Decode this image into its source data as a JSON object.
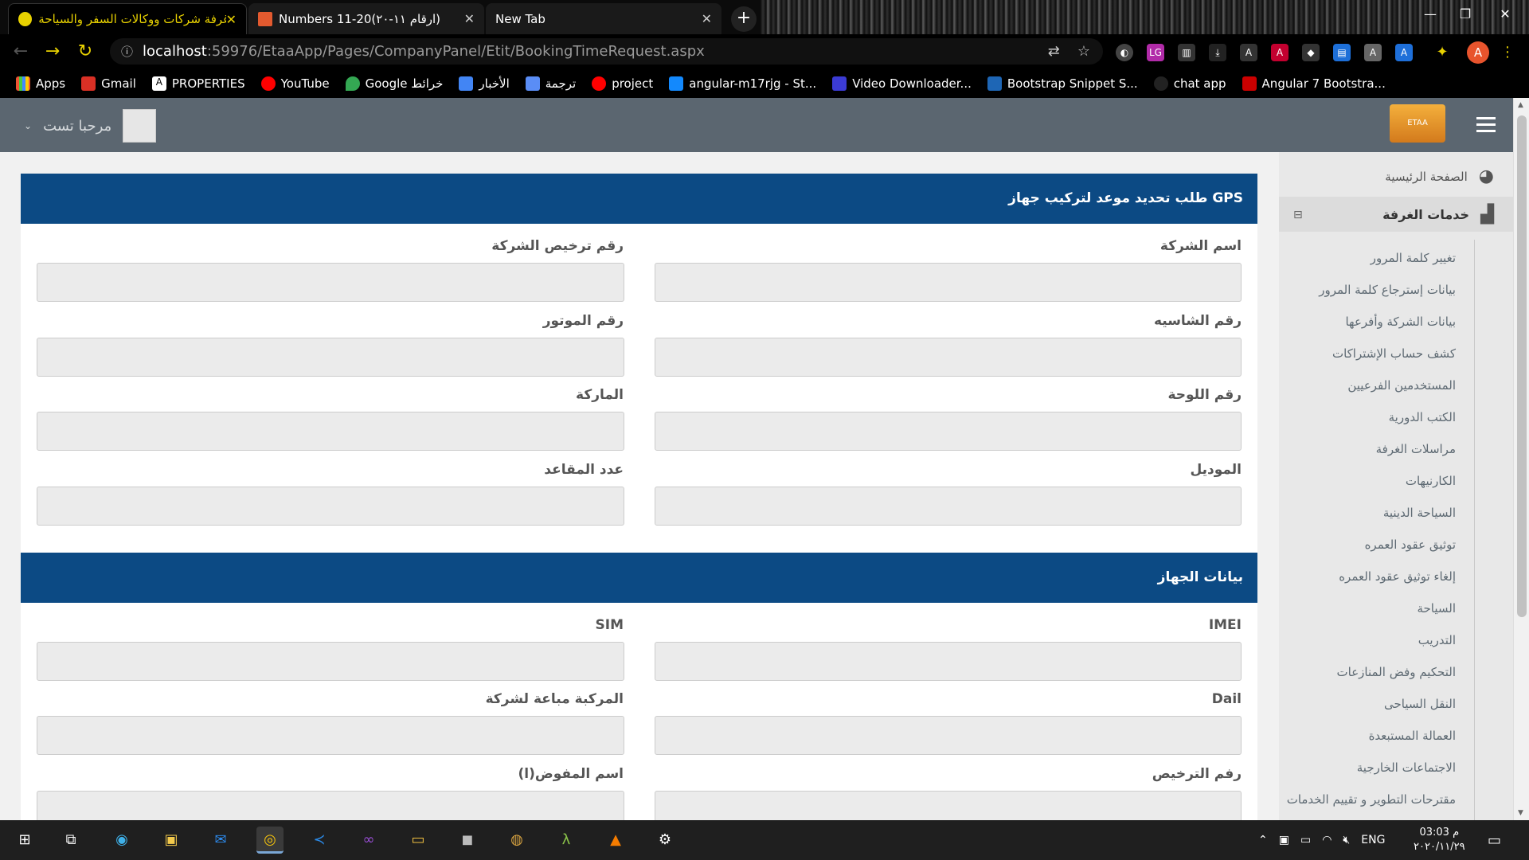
{
  "browser": {
    "tabs": [
      {
        "title": "غرفة شركات ووكالات السفر والسياحة",
        "active": true
      },
      {
        "title": "Numbers 11-20(ارقام ١١-٢٠)",
        "active": false
      },
      {
        "title": "New Tab",
        "active": false
      }
    ],
    "url": {
      "scheme_host": "localhost",
      "port_path": ":59976/EtaaApp/Pages/CompanyPanel/Etit/BookingTimeRequest.aspx"
    },
    "avatar_letter": "A",
    "bookmarks": [
      "Apps",
      "Gmail",
      "PROPERTIES",
      "YouTube",
      "Google خرائط",
      "الأخبار",
      "ترجمة",
      "project",
      "angular-m17rjg - St...",
      "Video Downloader...",
      "Bootstrap Snippet S...",
      "chat app",
      "Angular 7 Bootstra..."
    ]
  },
  "header": {
    "greeting": "مرحبا تست",
    "logo_text": "ETAA"
  },
  "sidebar": {
    "home": "الصفحة الرئيسية",
    "services": "خدمات الغرفة",
    "sub_items": [
      "تغيير كلمة المرور",
      "بيانات إسترجاع كلمة المرور",
      "بيانات الشركة وأفرعها",
      "كشف حساب الإشتراكات",
      "المستخدمين الفرعيين",
      "الكتب الدورية",
      "مراسلات الغرفة",
      "الكارنيهات",
      "السياحة الدينية",
      "توثيق عقود العمره",
      "إلغاء توثيق عقود العمره",
      "السياحة",
      "التدريب",
      "التحكيم وفض المنازعات",
      "النقل السياحى",
      "العمالة المستبعدة",
      "الاجتماعات الخارجية",
      "مقترحات التطوير و تقييم الخدمات"
    ]
  },
  "form": {
    "section1_title": "طلب تحديد موعد لتركيب جهاز GPS",
    "section2_title": "بيانات الجهاز",
    "fields": {
      "company_name": "اسم الشركة",
      "company_license": "رقم ترخيص الشركة",
      "chassis": "رقم الشاسيه",
      "motor": "رقم الموتور",
      "plate": "رقم اللوحة",
      "brand": "الماركة",
      "model": "الموديل",
      "seats": "عدد المقاعد",
      "imei": "IMEI",
      "sim": "SIM",
      "dail": "Dail",
      "vehicle_sold": "المركبة مباعة لشركة",
      "license_no": "رفم الترخيص",
      "delegate_name": "اسم المفوض(ا)"
    }
  },
  "taskbar": {
    "lang": "ENG",
    "time": "03:03 م",
    "date": "٢٠٢٠/١١/٢٩"
  }
}
